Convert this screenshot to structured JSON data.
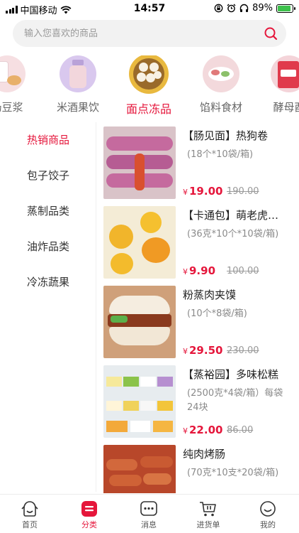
{
  "status_bar": {
    "carrier": "中国移动",
    "time": "14:57",
    "battery": "89%",
    "battery_level": 0.89
  },
  "search": {
    "placeholder": "输入您喜欢的商品"
  },
  "categories": [
    {
      "label": "奶豆浆",
      "icon": "soy-milk-image"
    },
    {
      "label": "米酒果饮",
      "icon": "rice-wine-image"
    },
    {
      "label": "面点冻品",
      "icon": "steamed-buns-image",
      "active": true
    },
    {
      "label": "馅料食材",
      "icon": "filling-ingredients-image"
    },
    {
      "label": "酵母酉",
      "icon": "yeast-image"
    }
  ],
  "side_nav": [
    {
      "label": "热销商品",
      "active": true
    },
    {
      "label": "包子饺子"
    },
    {
      "label": "蒸制品类"
    },
    {
      "label": "油炸品类"
    },
    {
      "label": "冷冻蔬果"
    }
  ],
  "products": [
    {
      "name": "【肠见面】热狗卷",
      "spec": "(18个*10袋/箱)",
      "currency": "¥",
      "price": "19.00",
      "old_price": "190.00",
      "image": "hot-dog-roll-image"
    },
    {
      "name": "【卡通包】萌老虎…",
      "spec": "(36克*10个*10袋/箱)",
      "currency": "¥",
      "price": "9.90",
      "old_price": "100.00",
      "image": "tiger-bun-image"
    },
    {
      "name": "粉蒸肉夹馍",
      "spec": "(10个*8袋/箱)",
      "currency": "¥",
      "price": "29.50",
      "old_price": "230.00",
      "image": "meat-bun-image"
    },
    {
      "name": "【蒸裕园】多味松糕",
      "spec": "(2500克*4袋/箱）每袋24块",
      "currency": "¥",
      "price": "22.00",
      "old_price": "86.00",
      "image": "sponge-cake-image"
    },
    {
      "name": "纯肉烤肠",
      "spec": "(70克*10支*20袋/箱)",
      "currency": "¥",
      "price": "",
      "old_price": "",
      "image": "sausage-image"
    }
  ],
  "tab_bar": [
    {
      "label": "首页",
      "icon": "home-icon"
    },
    {
      "label": "分类",
      "icon": "category-icon",
      "active": true
    },
    {
      "label": "消息",
      "icon": "message-icon"
    },
    {
      "label": "进货单",
      "icon": "cart-icon"
    },
    {
      "label": "我的",
      "icon": "profile-icon"
    }
  ],
  "colors": {
    "accent": "#e5163b",
    "battery_green": "#3cc14b"
  }
}
